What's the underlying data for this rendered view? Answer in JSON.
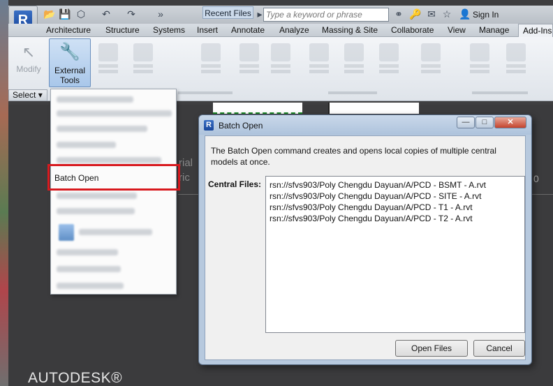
{
  "quick_access": {
    "recent_files": "Recent Files",
    "search_placeholder": "Type a keyword or phrase",
    "sign_in": "Sign In"
  },
  "ribbon_tabs": [
    "Architecture",
    "Structure",
    "Systems",
    "Insert",
    "Annotate",
    "Analyze",
    "Massing & Site",
    "Collaborate",
    "View",
    "Manage",
    "Add-Ins"
  ],
  "ribbon": {
    "modify_label": "Modify",
    "external_tools_label_1": "External",
    "external_tools_label_2": "Tools",
    "select_label": "Select"
  },
  "dropdown": {
    "highlighted_item": "Batch Open"
  },
  "dialog": {
    "title": "Batch Open",
    "description": "The Batch Open command creates and opens local copies of multiple central models at once.",
    "central_files_label": "Central Files:",
    "files": [
      "rsn://sfvs903/Poly Chengdu Dayuan/A/PCD - BSMT - A.rvt",
      "rsn://sfvs903/Poly Chengdu Dayuan/A/PCD - SITE - A.rvt",
      "rsn://sfvs903/Poly Chengdu Dayuan/A/PCD - T1 - A.rvt",
      "rsn://sfvs903/Poly Chengdu Dayuan/A/PCD - T2 - A.rvt"
    ],
    "open_button": "Open Files",
    "cancel_button": "Cancel"
  },
  "footer": {
    "brand": "AUTODESK®"
  },
  "background": {
    "text_1": "rial",
    "text_2": "ric",
    "text_3": "0"
  }
}
